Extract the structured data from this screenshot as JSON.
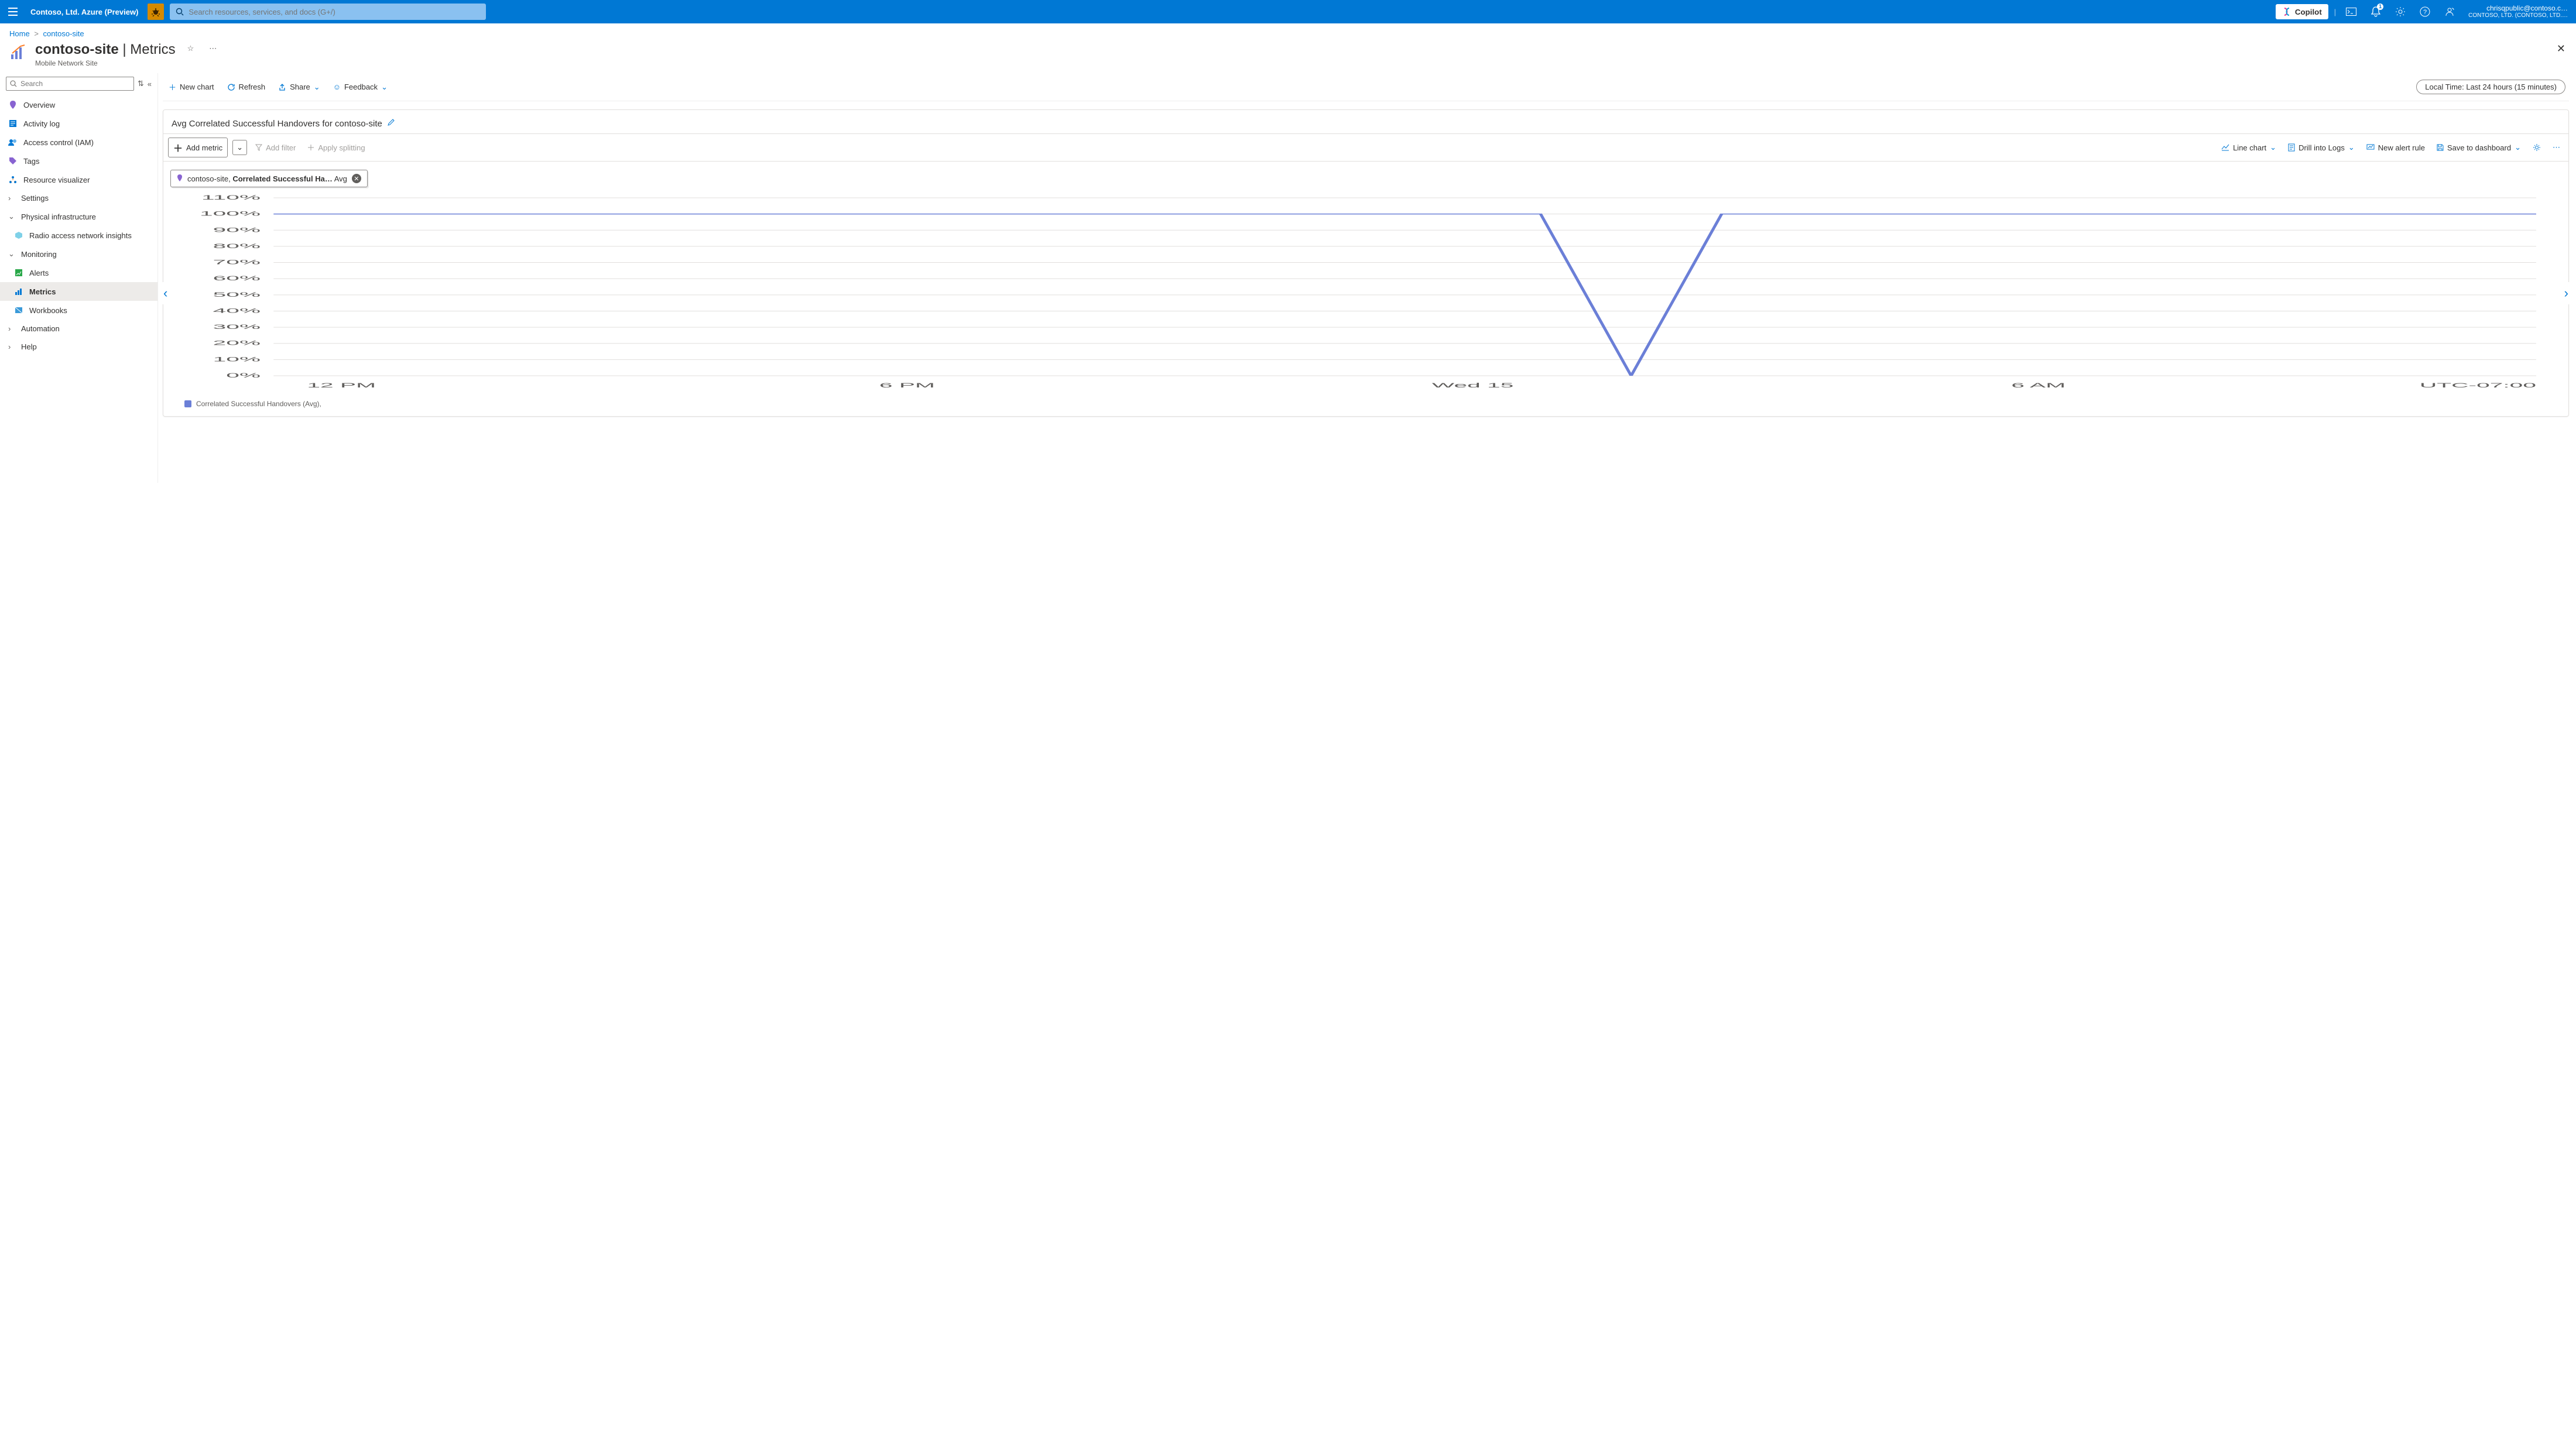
{
  "topbar": {
    "brand": "Contoso, Ltd. Azure (Preview)",
    "search_placeholder": "Search resources, services, and docs (G+/)",
    "copilot_label": "Copilot",
    "notif_badge": "1",
    "account_line1": "chrisqpublic@contoso.c…",
    "account_line2": "CONTOSO, LTD. (CONTOSO, LTD.…"
  },
  "breadcrumb": {
    "home": "Home",
    "item": "contoso-site"
  },
  "page": {
    "title_main": "contoso-site",
    "title_sep": " | ",
    "title_tail": "Metrics",
    "subtitle": "Mobile Network Site"
  },
  "leftnav": {
    "search_placeholder": "Search",
    "items": {
      "overview": "Overview",
      "activity": "Activity log",
      "iam": "Access control (IAM)",
      "tags": "Tags",
      "visualizer": "Resource visualizer",
      "settings": "Settings",
      "phys_header": "Physical infrastructure",
      "ran": "Radio access network insights",
      "mon_header": "Monitoring",
      "alerts": "Alerts",
      "metrics": "Metrics",
      "workbooks": "Workbooks",
      "automation": "Automation",
      "help": "Help"
    }
  },
  "cmdbar": {
    "new_chart": "New chart",
    "refresh": "Refresh",
    "share": "Share",
    "feedback": "Feedback",
    "time_label": "Local Time: Last 24 hours (15 minutes)"
  },
  "panel": {
    "title": "Avg Correlated Successful Handovers for contoso-site",
    "add_metric": "Add metric",
    "add_filter": "Add filter",
    "apply_split": "Apply splitting",
    "line_chart": "Line chart",
    "drill_logs": "Drill into Logs",
    "new_alert": "New alert rule",
    "save_dash": "Save to dashboard"
  },
  "metric_pill": {
    "scope": "contoso-site, ",
    "metric": "Correlated Successful Ha…",
    "agg": " Avg"
  },
  "legend": {
    "series1": "Correlated Successful Handovers (Avg),"
  },
  "chart_data": {
    "type": "line",
    "title": "Avg Correlated Successful Handovers for contoso-site",
    "ylabel": "%",
    "ylim": [
      0,
      110
    ],
    "y_ticks": [
      0,
      10,
      20,
      30,
      40,
      50,
      60,
      70,
      80,
      90,
      100,
      110
    ],
    "x_ticks": [
      "12 PM",
      "6 PM",
      "Wed 15",
      "6 AM"
    ],
    "timezone_label": "UTC-07:00",
    "series": [
      {
        "name": "Correlated Successful Handovers (Avg)",
        "color": "#6b7fd7",
        "x": [
          "12 PM",
          "1 PM",
          "2 PM",
          "3 PM",
          "4 PM",
          "5 PM",
          "6 PM",
          "7 PM",
          "8 PM",
          "9 PM",
          "10 PM",
          "11 PM",
          "Wed 15",
          "1 AM",
          "1:30 AM",
          "1:45 AM",
          "2 AM",
          "3 AM",
          "4 AM",
          "5 AM",
          "6 AM",
          "7 AM",
          "8 AM",
          "9 AM",
          "10 AM",
          "11 AM"
        ],
        "values": [
          100,
          100,
          100,
          100,
          100,
          100,
          100,
          100,
          100,
          100,
          100,
          100,
          100,
          100,
          100,
          0,
          100,
          100,
          100,
          100,
          100,
          100,
          100,
          100,
          100,
          100
        ]
      }
    ]
  }
}
